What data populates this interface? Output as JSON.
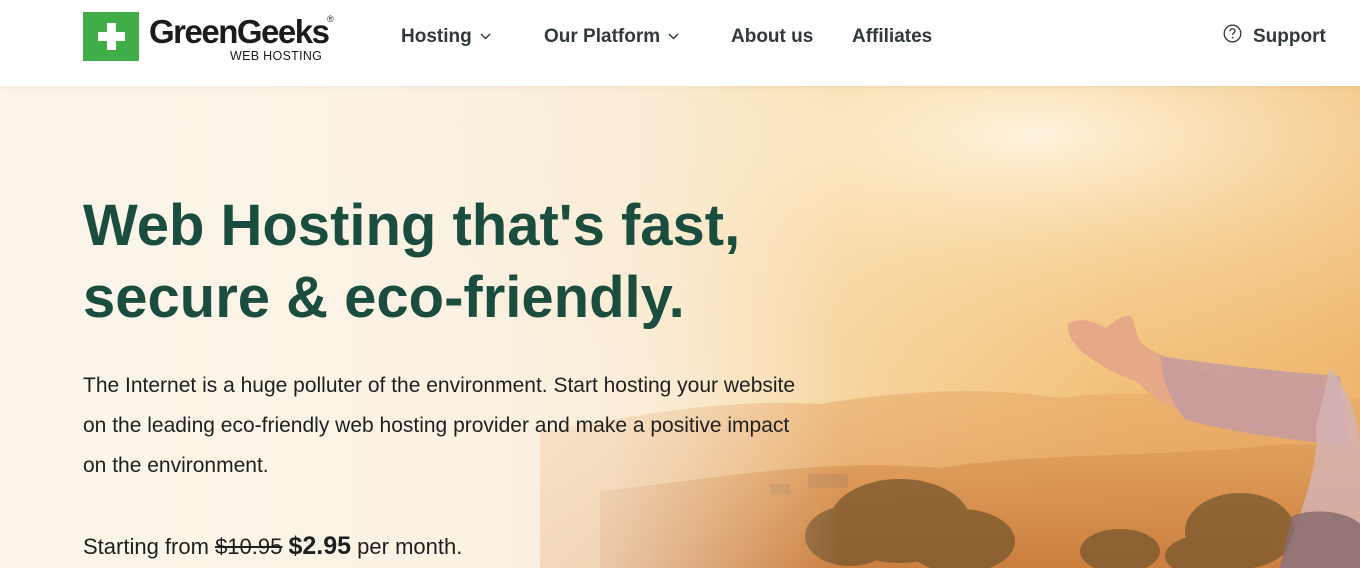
{
  "logo": {
    "name": "GreenGeeks",
    "registered": "®",
    "subtitle": "WEB HOSTING",
    "brand_color": "#3fae49"
  },
  "nav": {
    "hosting": "Hosting",
    "platform": "Our Platform",
    "about": "About us",
    "affiliates": "Affiliates",
    "support": "Support"
  },
  "hero": {
    "headline": "Web Hosting that's fast, secure & eco-friendly.",
    "description": "The Internet is a huge polluter of the environment. Start hosting your website on the leading eco-friendly web hosting provider and make a positive impact on the environment.",
    "price_prefix": "Starting from",
    "old_price": "$10.95",
    "new_price": "$2.95",
    "price_suffix": "per month.",
    "headline_color": "#1b4d3e"
  },
  "icons": {
    "logo_mark": "plus-icon",
    "dropdown": "chevron-down-icon",
    "support": "help-circle-icon"
  }
}
